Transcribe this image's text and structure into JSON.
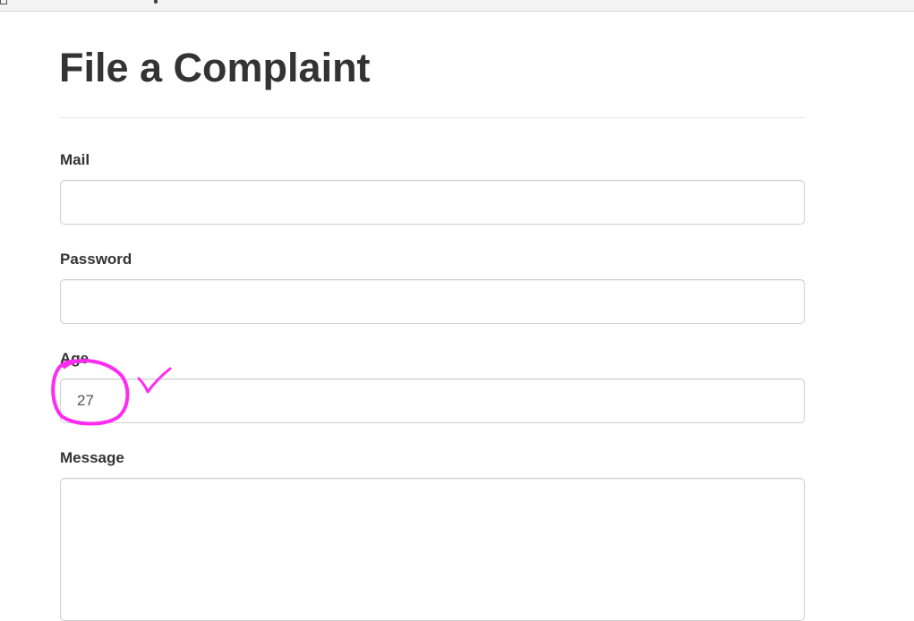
{
  "page": {
    "title": "File a Complaint"
  },
  "form": {
    "mail": {
      "label": "Mail",
      "value": "",
      "placeholder": ""
    },
    "password": {
      "label": "Password",
      "value": "",
      "placeholder": ""
    },
    "age": {
      "label": "Age",
      "value": "27",
      "placeholder": ""
    },
    "message": {
      "label": "Message",
      "value": "",
      "placeholder": ""
    }
  },
  "annotation": {
    "color": "#ff2bf0",
    "shapes": [
      "circle",
      "checkmark"
    ]
  }
}
